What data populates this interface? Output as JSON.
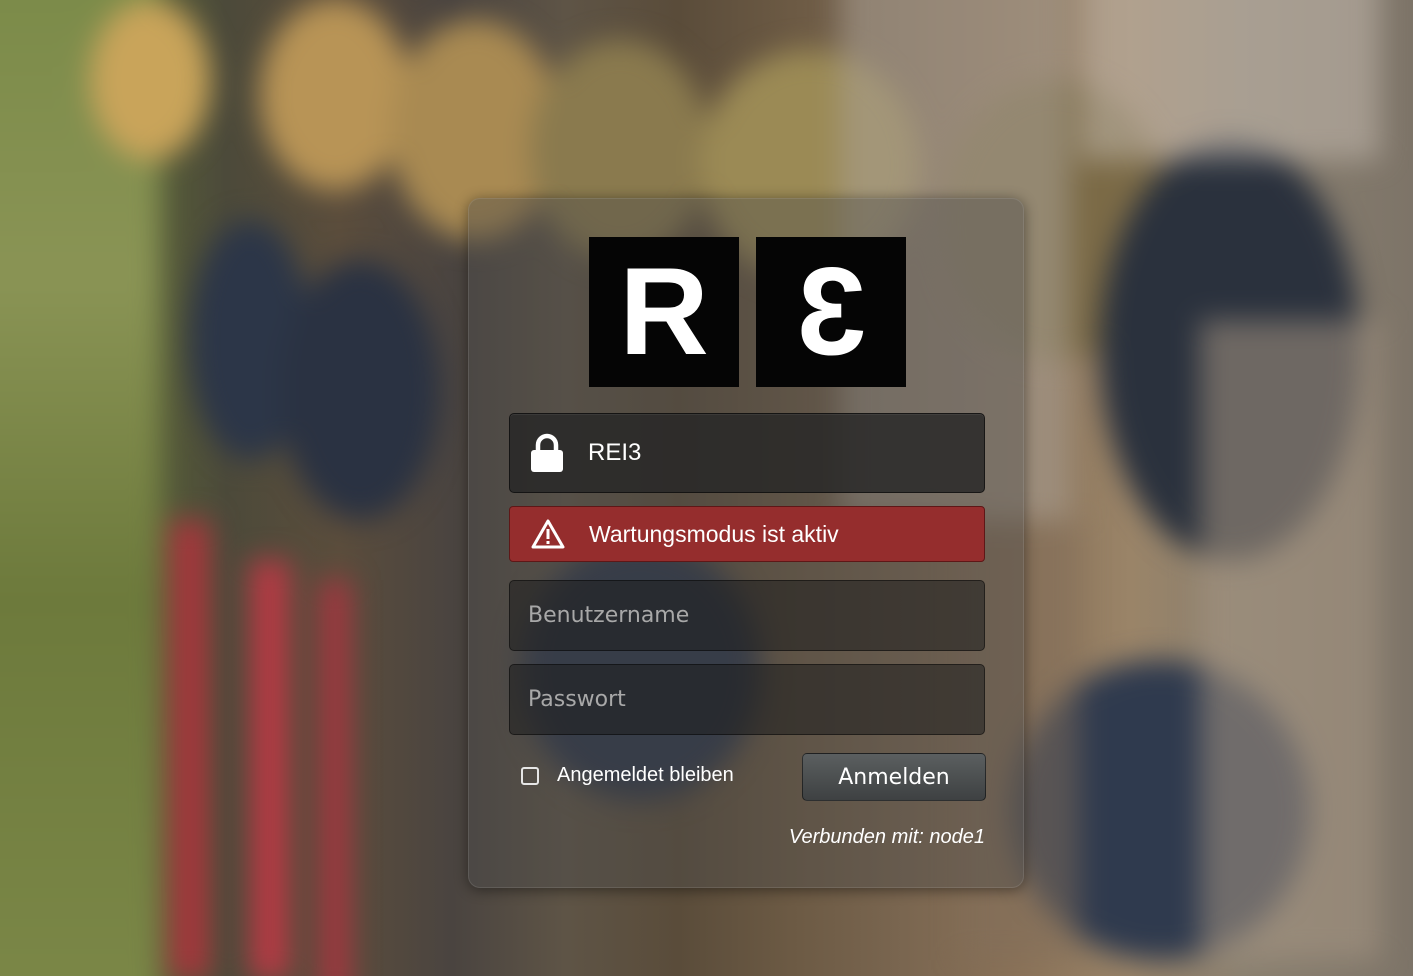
{
  "logo": {
    "left_letter": "R",
    "right_letter": "3"
  },
  "instance": {
    "icon": "lock-icon",
    "name": "REI3"
  },
  "alert": {
    "icon": "warning-icon",
    "message": "Wartungsmodus ist aktiv",
    "color": "#952d2d"
  },
  "form": {
    "username_value": "",
    "username_placeholder": "Benutzername",
    "password_value": "",
    "password_placeholder": "Passwort",
    "remember_label": "Angemeldet bleiben",
    "remember_checked": false,
    "login_label": "Anmelden"
  },
  "footer": {
    "connected": "Verbunden mit: node1"
  }
}
